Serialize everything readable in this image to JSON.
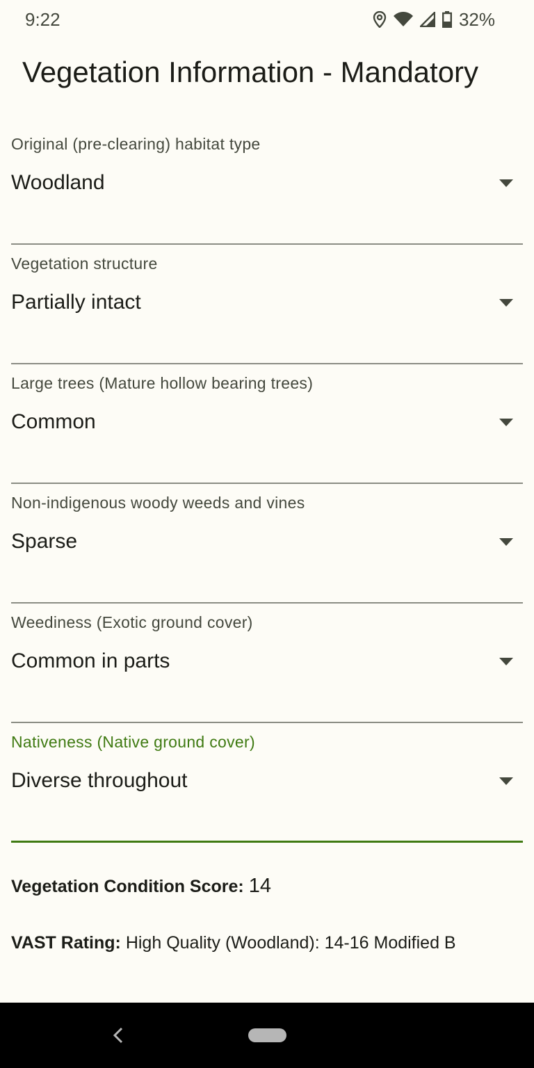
{
  "status_bar": {
    "time": "9:22",
    "battery": "32%",
    "icons": [
      "location-icon",
      "wifi-icon",
      "cell-signal-icon",
      "battery-icon"
    ]
  },
  "title": "Vegetation Information - Mandatory",
  "fields": [
    {
      "label": "Original (pre-clearing) habitat type",
      "value": "Woodland"
    },
    {
      "label": "Vegetation structure",
      "value": "Partially intact"
    },
    {
      "label": "Large trees (Mature hollow bearing trees)",
      "value": "Common"
    },
    {
      "label": "Non-indigenous woody weeds and vines",
      "value": "Sparse"
    },
    {
      "label": "Weediness (Exotic ground cover)",
      "value": "Common in parts"
    },
    {
      "label": "Nativeness (Native ground cover)",
      "value": "Diverse throughout",
      "focused": true
    }
  ],
  "score": {
    "label": "Vegetation Condition Score:",
    "value": "14"
  },
  "vast": {
    "label": "VAST Rating:",
    "value": "High Quality (Woodland): 14-16 Modified B"
  },
  "colors": {
    "accent": "#3f7a12",
    "background": "#fdfcf6",
    "text": "#1b1c17",
    "label": "#44483d"
  }
}
